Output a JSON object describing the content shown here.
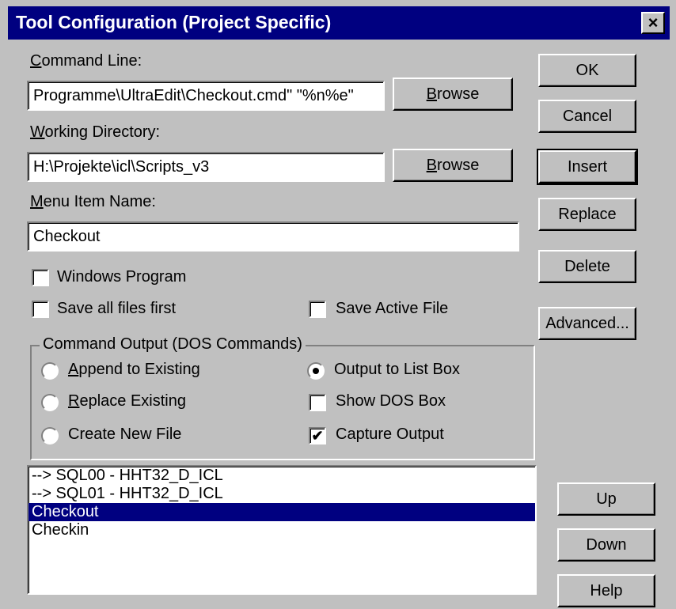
{
  "window": {
    "title": "Tool Configuration (Project Specific)",
    "close_glyph": "×"
  },
  "fields": {
    "command_line": {
      "label": "Command Line:",
      "value": "Programme\\UltraEdit\\Checkout.cmd\" \"%n%e\"",
      "browse": "Browse"
    },
    "working_directory": {
      "label": "Working Directory:",
      "value": "H:\\Projekte\\icl\\Scripts_v3",
      "browse": "Browse"
    },
    "menu_item_name": {
      "label": "Menu Item Name:",
      "value": "Checkout"
    }
  },
  "options": {
    "windows_program": {
      "label": "Windows Program",
      "checked": false
    },
    "save_all_files_first": {
      "label": "Save all files first",
      "checked": false
    },
    "save_active_file": {
      "label": "Save Active File",
      "checked": false
    }
  },
  "output_group": {
    "title": "Command Output (DOS Commands)",
    "append_to_existing": {
      "label": "Append to Existing",
      "selected": false
    },
    "replace_existing": {
      "label": "Replace Existing",
      "selected": false
    },
    "create_new_file": {
      "label": "Create New File",
      "selected": false
    },
    "output_to_list_box": {
      "label": "Output to List Box",
      "selected": true
    },
    "show_dos_box": {
      "label": "Show DOS Box",
      "checked": false
    },
    "capture_output": {
      "label": "Capture Output",
      "checked": true
    }
  },
  "tool_list": {
    "items": [
      "--> SQL00 - HHT32_D_ICL",
      "--> SQL01 - HHT32_D_ICL",
      "Checkout",
      "Checkin"
    ],
    "selected_index": 2
  },
  "buttons": {
    "ok": "OK",
    "cancel": "Cancel",
    "insert": "Insert",
    "replace": "Replace",
    "delete": "Delete",
    "advanced": "Advanced...",
    "up": "Up",
    "down": "Down",
    "help": "Help"
  },
  "colors": {
    "face": "#c0c0c0",
    "titlebar": "#000080",
    "selection": "#000080"
  }
}
